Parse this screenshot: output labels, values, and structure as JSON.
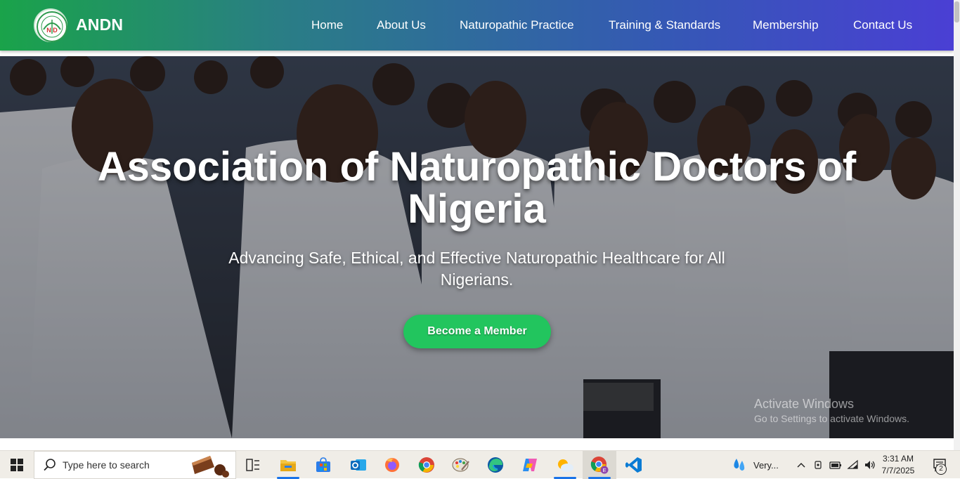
{
  "header": {
    "brand": "ANDN",
    "logo_icon": "andn-emblem-icon",
    "nav": [
      {
        "label": "Home"
      },
      {
        "label": "About Us"
      },
      {
        "label": "Naturopathic Practice"
      },
      {
        "label": "Training & Standards"
      },
      {
        "label": "Membership"
      },
      {
        "label": "Contact Us"
      }
    ]
  },
  "hero": {
    "title_line1": "Association of Naturopathic Doctors of",
    "title_line2": "Nigeria",
    "subtitle": "Advancing Safe, Ethical, and Effective Naturopathic Healthcare for All Nigerians.",
    "cta_label": "Become a Member",
    "background": "group of doctors in white coats"
  },
  "watermark": {
    "line1": "Activate Windows",
    "line2": "Go to Settings to activate Windows."
  },
  "taskbar": {
    "search_placeholder": "Type here to search",
    "apps": [
      "task-view-icon",
      "file-explorer-icon",
      "microsoft-store-icon",
      "outlook-icon",
      "firefox-icon",
      "chrome-icon",
      "paint-icon",
      "edge-icon",
      "copilot-icon",
      "weather-icon",
      "chrome-profile-icon",
      "vscode-icon"
    ],
    "weather_text": "Very...",
    "time": "3:31 AM",
    "date": "7/7/2025",
    "notification_count": "2"
  },
  "colors": {
    "header_gradient_start": "#1aa34a",
    "header_gradient_end": "#4a3fd4",
    "cta": "#22c55e"
  }
}
